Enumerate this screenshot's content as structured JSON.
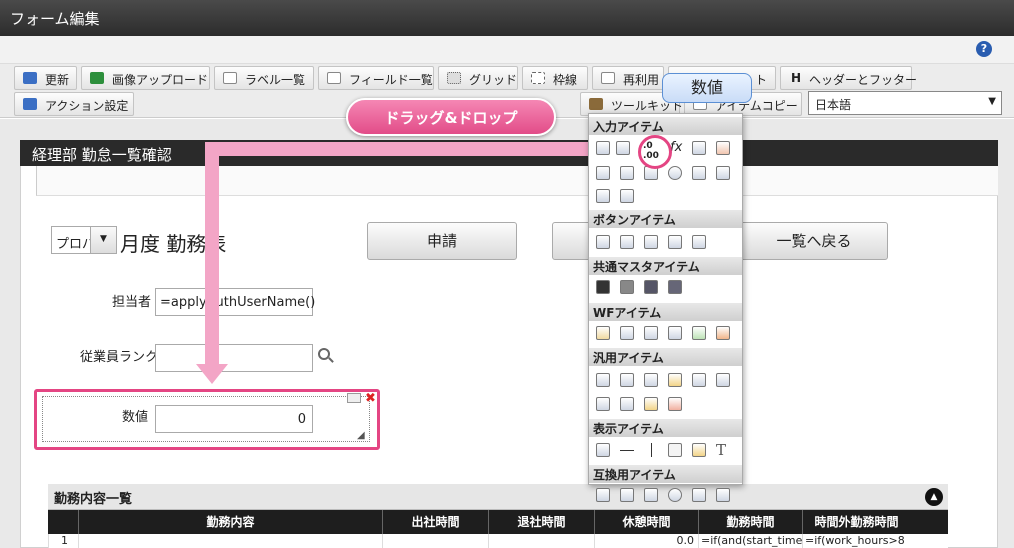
{
  "window": {
    "title": "フォーム編集"
  },
  "toolbar": {
    "buttons": [
      {
        "label": "更新",
        "color": "#3b6fc4"
      },
      {
        "label": "画像アップロード",
        "color": "#2d8f3c"
      },
      {
        "label": "ラベル一覧",
        "color": "#777777"
      },
      {
        "label": "フィールド一覧",
        "color": "#777777"
      },
      {
        "label": "グリッド",
        "color": "#999999"
      },
      {
        "label": "枠線",
        "color": "#999999"
      },
      {
        "label": "再利用",
        "color": "#888888"
      },
      {
        "label": "ト",
        "color": "#888888"
      },
      {
        "label": "ヘッダーとフッター",
        "color": "#333333"
      },
      {
        "label": "アクション設定",
        "color": "#3b6fc4"
      },
      {
        "label": "ツールキット",
        "color": "#8a6a3a"
      },
      {
        "label": "アイテムコピー",
        "color": "#777777"
      }
    ],
    "h_glyph": "H",
    "language": "日本語"
  },
  "callouts": {
    "field_label": "数値",
    "drag_drop": "ドラッグ&ドロップ"
  },
  "sheet": {
    "header": "経理部 勤怠一覧確認",
    "combo_value": "プロパ",
    "form_title": "月度 勤務表",
    "buttons": {
      "apply": "申請",
      "back": "一覧へ戻る"
    },
    "fields": {
      "manager_label": "担当者",
      "manager_value": "=applyAuthUserName()",
      "rank_label": "従業員ランク",
      "number_label": "数値",
      "number_value": "0"
    },
    "table": {
      "title": "勤務内容一覧",
      "headers": [
        "勤務内容",
        "出社時間",
        "退社時間",
        "休憩時間",
        "勤務時間",
        "時間外勤務時間"
      ],
      "row1": {
        "no": "1",
        "break": "0.0",
        "work": "=if(and(start_time",
        "overtime": "=if(work_hours>8"
      }
    }
  },
  "palette": {
    "sections": [
      "入力アイテム",
      "ボタンアイテム",
      "共通マスタアイテム",
      "WFアイテム",
      "汎用アイテム",
      "表示アイテム",
      "互換用アイテム"
    ],
    "numeric_glyph": ".0\n.00",
    "formula_glyph": "fx",
    "text_glyph": "T"
  },
  "colors": {
    "accent_pink": "#e44583",
    "callout_blue": "#5b8fd4",
    "header_dark": "#2a2a2a"
  }
}
